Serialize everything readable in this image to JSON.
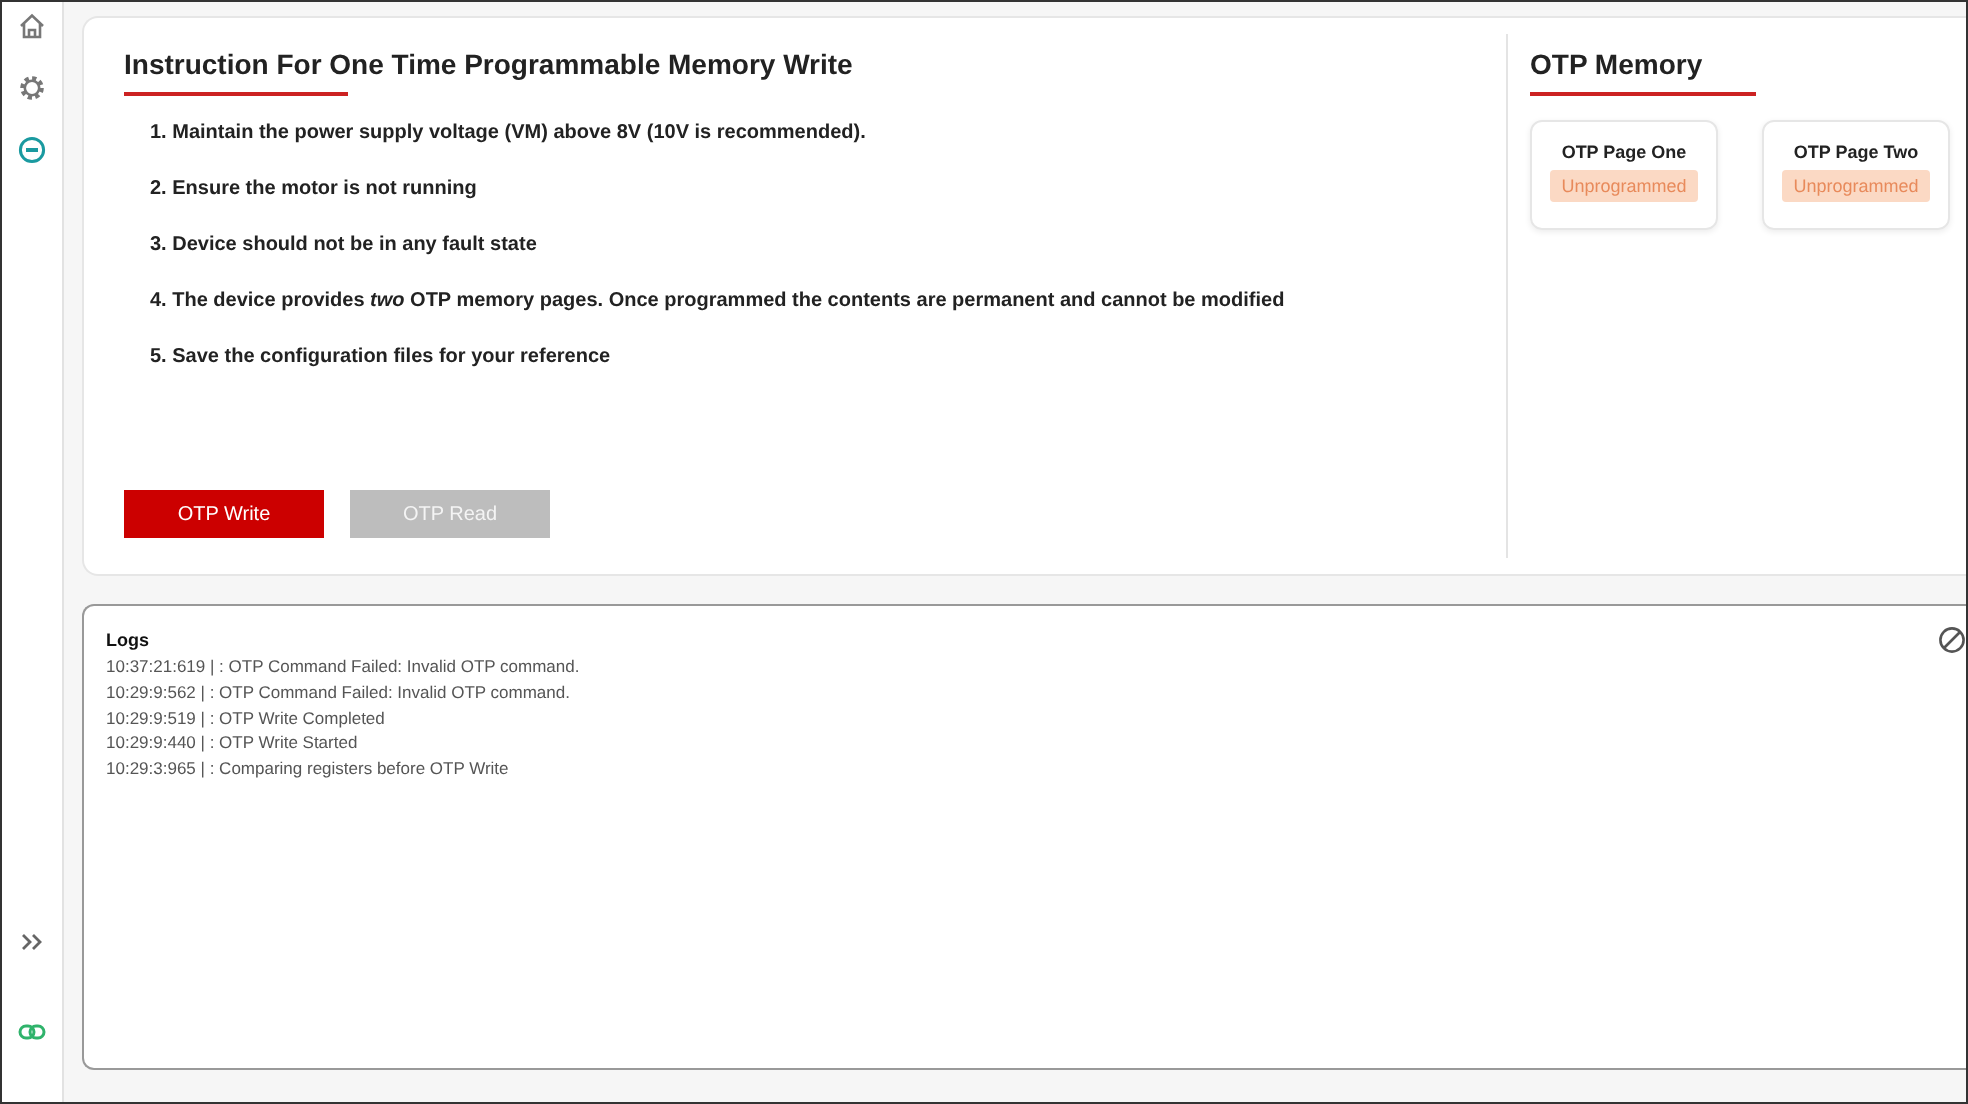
{
  "sidebar": {
    "items": [
      {
        "kind": "home",
        "selected": false
      },
      {
        "kind": "settings",
        "selected": false
      },
      {
        "kind": "otp",
        "selected": true
      }
    ],
    "bottom": [
      {
        "kind": "expand"
      },
      {
        "kind": "link"
      }
    ]
  },
  "instructions": {
    "title": "Instruction For One Time Programmable Memory Write",
    "steps": [
      "1. Maintain the power supply voltage (VM) above 8V (10V is recommended).",
      "2. Ensure the motor is not running",
      "3. Device should not be in any fault state",
      "4. The device provides *two* OTP memory pages. Once programmed the contents are permanent and cannot be modified",
      "5. Save the configuration files for your reference"
    ],
    "buttons": [
      {
        "label": "OTP Write",
        "disabled": false
      },
      {
        "label": "OTP Read",
        "disabled": true
      }
    ]
  },
  "otp_memory": {
    "title": "OTP Memory",
    "pages": [
      {
        "name": "OTP Page One",
        "status": "Unprogrammed"
      },
      {
        "name": "OTP Page Two",
        "status": "Unprogrammed"
      }
    ]
  },
  "logs": {
    "title": "Logs",
    "entries": [
      "10:37:21:619 | : OTP Command Failed: Invalid OTP command.",
      "10:29:9:562 | : OTP Command Failed: Invalid OTP command.",
      "10:29:9:519 | : OTP Write Completed",
      "10:29:9:440 | : OTP Write Started",
      "10:29:3:965 | : Comparing registers before OTP Write"
    ]
  }
}
